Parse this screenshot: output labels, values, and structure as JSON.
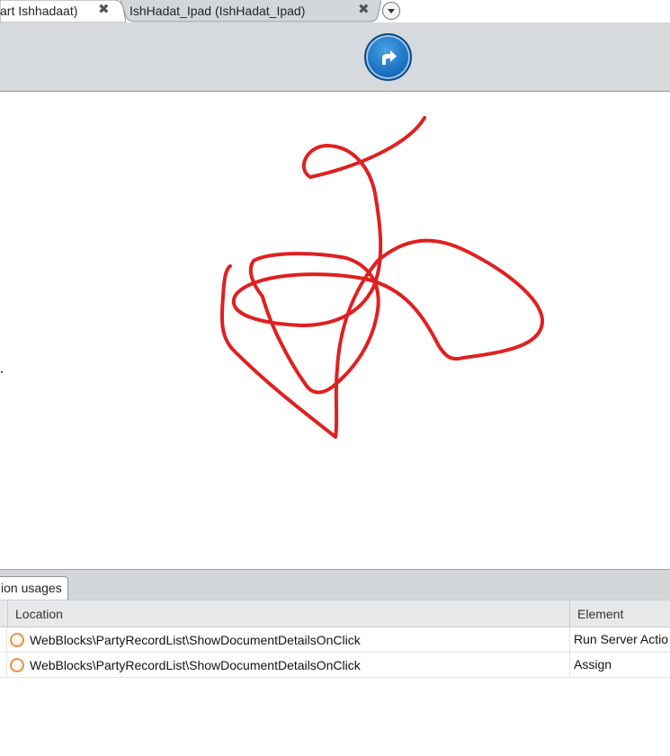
{
  "tabs": [
    {
      "label": "art Ishhadaat)",
      "close": "✖"
    },
    {
      "label": "IshHadat_Ipad (IshHadat_Ipad)",
      "close": "✖"
    }
  ],
  "toolbar": {
    "go_button_icon": "arrow-forward-icon"
  },
  "canvas": {
    "stroke_color": "#e02020"
  },
  "bottom_panel": {
    "tab_label": "ion usages",
    "columns": [
      "Location",
      "Element"
    ],
    "rows": [
      {
        "location": "WebBlocks\\PartyRecordList\\ShowDocumentDetailsOnClick",
        "element": "Run Server Actio"
      },
      {
        "location": "WebBlocks\\PartyRecordList\\ShowDocumentDetailsOnClick",
        "element": "Assign"
      }
    ]
  },
  "colors": {
    "toolbar_bg": "#d6dadd",
    "accent_blue": "#1d75c6",
    "row_icon_orange": "#e8934a"
  }
}
